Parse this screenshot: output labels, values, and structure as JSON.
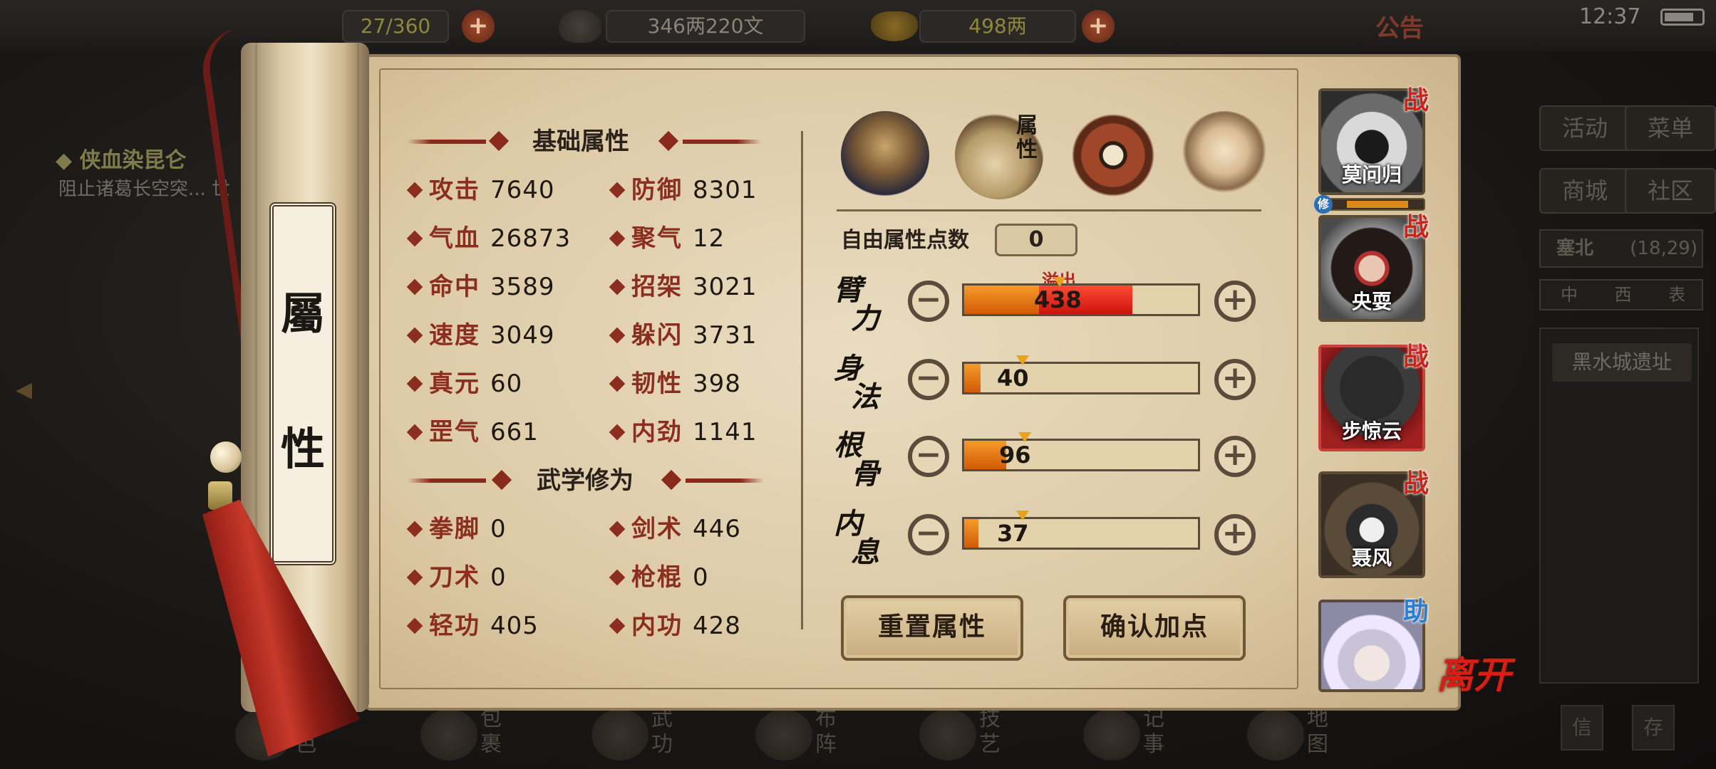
{
  "top": {
    "stamina": "27/360",
    "money": "346两220文",
    "gold": "498两",
    "notice": "公告",
    "clock": "12:37"
  },
  "quest": {
    "title": "◆ 侠血染昆仑",
    "desc": "阻止诸葛长空突... 世"
  },
  "right_panel": {
    "buttons": [
      "活动",
      "菜单",
      "商城",
      "社区"
    ],
    "location": "塞北",
    "coords": "(18,29)",
    "compass": "中 西 表",
    "map_name": "黑水城遗址",
    "small_buttons": [
      "信",
      "存"
    ]
  },
  "bottom_nav": [
    "角色",
    "包裹",
    "武功",
    "布阵",
    "技艺",
    "记事",
    "地图"
  ],
  "scroll_label": [
    "屬",
    "性"
  ],
  "basic": {
    "title": "基础属性",
    "stats": [
      {
        "name": "攻击",
        "value": "7640"
      },
      {
        "name": "防御",
        "value": "8301"
      },
      {
        "name": "气血",
        "value": "26873"
      },
      {
        "name": "聚气",
        "value": "12"
      },
      {
        "name": "命中",
        "value": "3589"
      },
      {
        "name": "招架",
        "value": "3021"
      },
      {
        "name": "速度",
        "value": "3049"
      },
      {
        "name": "躲闪",
        "value": "3731"
      },
      {
        "name": "真元",
        "value": "60"
      },
      {
        "name": "韧性",
        "value": "398"
      },
      {
        "name": "罡气",
        "value": "661"
      },
      {
        "name": "内劲",
        "value": "1141"
      }
    ]
  },
  "martial": {
    "title": "武学修为",
    "stats": [
      {
        "name": "拳脚",
        "value": "0"
      },
      {
        "name": "剑术",
        "value": "446"
      },
      {
        "name": "刀术",
        "value": "0"
      },
      {
        "name": "枪棍",
        "value": "0"
      },
      {
        "name": "轻功",
        "value": "405"
      },
      {
        "name": "内功",
        "value": "428"
      }
    ]
  },
  "tabs": {
    "attr_tab_label": "属性"
  },
  "free_points": {
    "label": "自由属性点数",
    "value": "0"
  },
  "overflow_label": "溢出",
  "attributes": [
    {
      "name": "臂力",
      "value": "438",
      "fill": 0.32,
      "overflow_fill": 0.4,
      "marker": 0.41
    },
    {
      "name": "身法",
      "value": "40",
      "fill": 0.07,
      "overflow_fill": 0,
      "marker": 0.25
    },
    {
      "name": "根骨",
      "value": "96",
      "fill": 0.18,
      "overflow_fill": 0,
      "marker": 0.26
    },
    {
      "name": "内息",
      "value": "37",
      "fill": 0.06,
      "overflow_fill": 0,
      "marker": 0.25
    }
  ],
  "buttons": {
    "reset": "重置属性",
    "confirm": "确认加点"
  },
  "party": [
    {
      "name": "莫问归",
      "tag": "战",
      "tag_color": "#c8261a"
    },
    {
      "name": "央耍",
      "tag": "战",
      "tag_color": "#c8261a"
    },
    {
      "name": "步惊云",
      "tag": "战",
      "tag_color": "#c8261a"
    },
    {
      "name": "聂风",
      "tag": "战",
      "tag_color": "#c8261a"
    },
    {
      "name": "",
      "tag": "助",
      "tag_color": "#2a7fd0"
    }
  ],
  "party_extra_badge": "修",
  "leave_label": "离开",
  "colors": {
    "stat_name": "#8b2d1f",
    "bar_fill": "#e07010",
    "bar_overflow": "#e0261a"
  }
}
